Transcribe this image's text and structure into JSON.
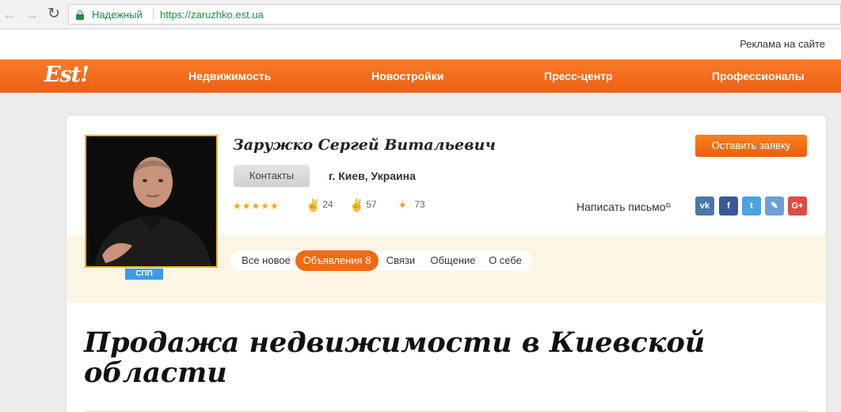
{
  "browser": {
    "back_icon": "arrow-left-icon",
    "forward_icon": "arrow-right-icon",
    "reload_icon": "reload-icon",
    "secure_label": "Надежный",
    "url": "https://zaruzhko.est.ua"
  },
  "top_strip": {
    "ads_link": "Реклама на сайте"
  },
  "header": {
    "logo": "Est!",
    "nav": [
      "Недвижимость",
      "Новостройки",
      "Пресс-центр",
      "Профессионалы"
    ],
    "background_color": "#f26a16"
  },
  "profile": {
    "name": "Заружко Сергей Витальевич",
    "badge": "СПП",
    "contacts_button": "Контакты",
    "location": "г. Киев, Украина",
    "rating_stars": "★★★★★",
    "rating_value": 5,
    "stats": [
      {
        "icon": "thumbs-up-icon",
        "value": "24"
      },
      {
        "icon": "thumbs-down-icon",
        "value": "57"
      },
      {
        "icon": "sparkle-icon",
        "value": "73"
      }
    ],
    "order_button": "Оставить заявку",
    "write_link": "Написать письмо",
    "social": [
      {
        "icon": "vk-icon",
        "label": "vk",
        "color": "#4a76a8"
      },
      {
        "icon": "facebook-icon",
        "label": "f",
        "color": "#3b5998"
      },
      {
        "icon": "twitter-icon",
        "label": "t",
        "color": "#4aa3df"
      },
      {
        "icon": "pencil-icon",
        "label": "✎",
        "color": "#6fa0d4"
      },
      {
        "icon": "google-plus-icon",
        "label": "G+",
        "color": "#dc4e41"
      }
    ]
  },
  "tabs": [
    {
      "label": "Все новое",
      "active": false
    },
    {
      "label": "Объявления 8",
      "active": true
    },
    {
      "label": "Связи",
      "active": false
    },
    {
      "label": "Общение",
      "active": false
    },
    {
      "label": "О себе",
      "active": false
    }
  ],
  "page_heading": "Продажа недвижимости в Киевской области"
}
